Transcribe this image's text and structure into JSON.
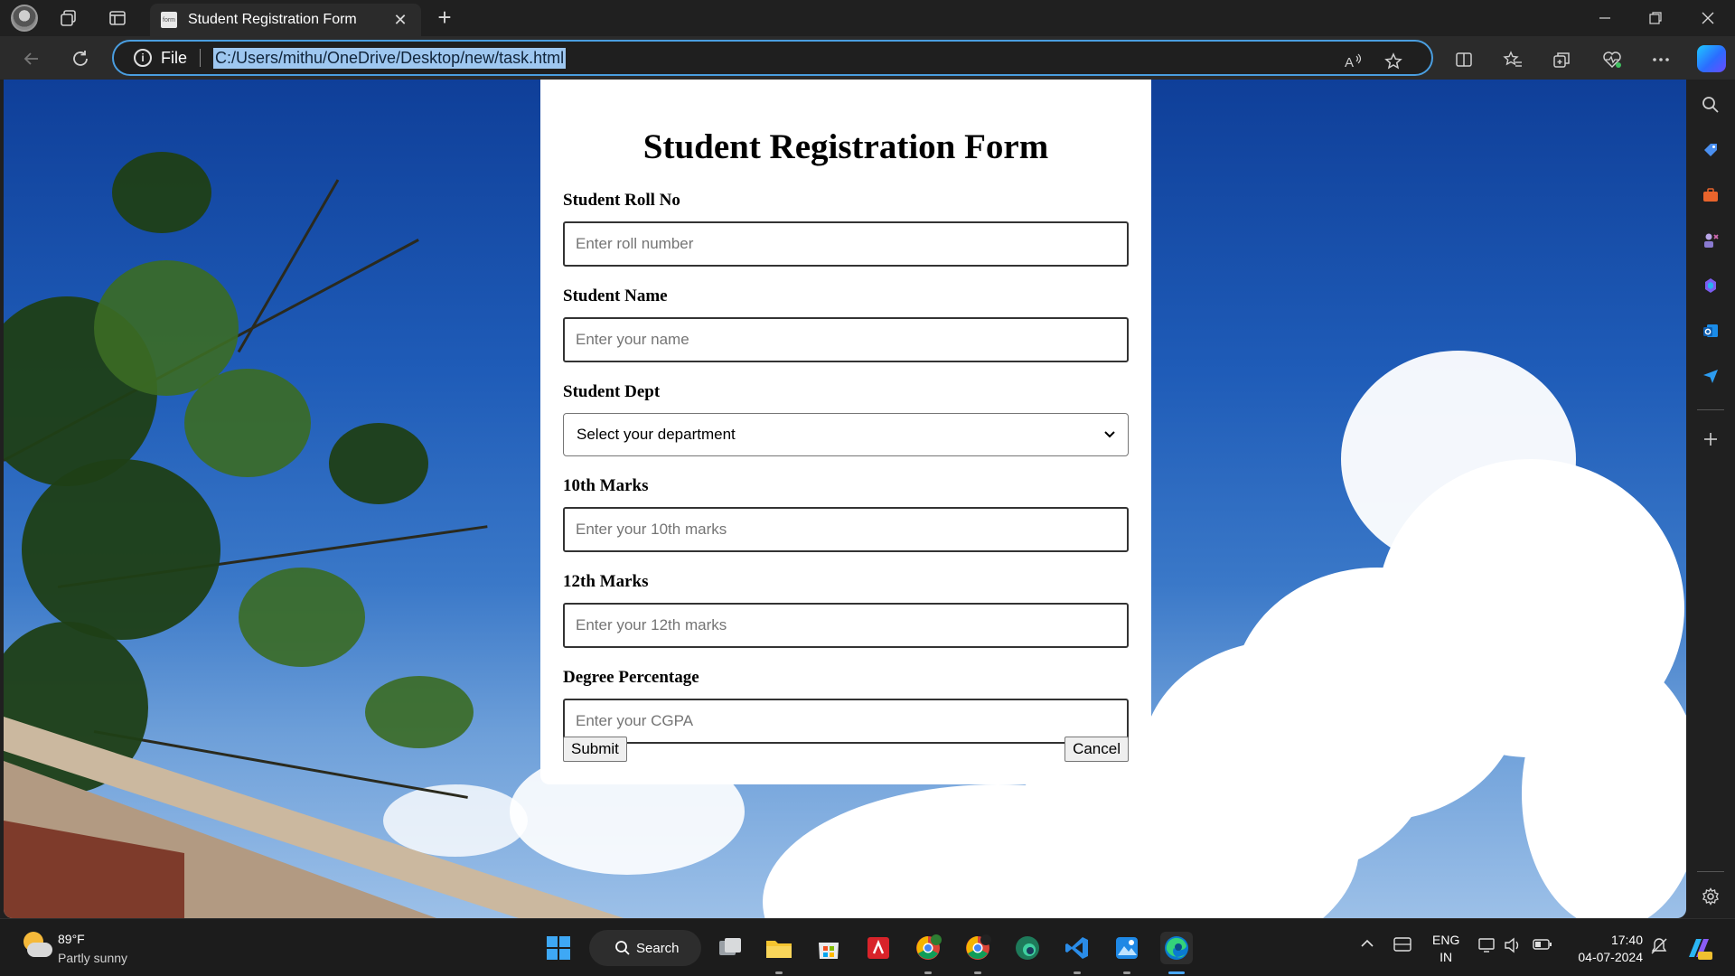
{
  "browser": {
    "tab_title": "Student Registration Form",
    "tab_favicon_text": "form",
    "new_tab_symbol": "+",
    "close_tab_symbol": "✕",
    "omnibox": {
      "scheme_label": "File",
      "url": "C:/Users/mithu/OneDrive/Desktop/new/task.html"
    },
    "accent_color": "#4a9ee0"
  },
  "form": {
    "title": "Student Registration Form",
    "fields": [
      {
        "label": "Student Roll No",
        "placeholder": "Enter roll number"
      },
      {
        "label": "Student Name",
        "placeholder": "Enter your name"
      },
      {
        "label": "Student Dept",
        "selected": "Select your department"
      },
      {
        "label": "10th Marks",
        "placeholder": "Enter your 10th marks"
      },
      {
        "label": "12th Marks",
        "placeholder": "Enter your 12th marks"
      },
      {
        "label": "Degree Percentage",
        "placeholder": "Enter your CGPA"
      }
    ],
    "submit_label": "Submit",
    "cancel_label": "Cancel"
  },
  "taskbar": {
    "weather": {
      "temp": "89°F",
      "desc": "Partly sunny"
    },
    "search_label": "Search",
    "lang_top": "ENG",
    "lang_bottom": "IN",
    "time": "17:40",
    "date": "04-07-2024"
  }
}
